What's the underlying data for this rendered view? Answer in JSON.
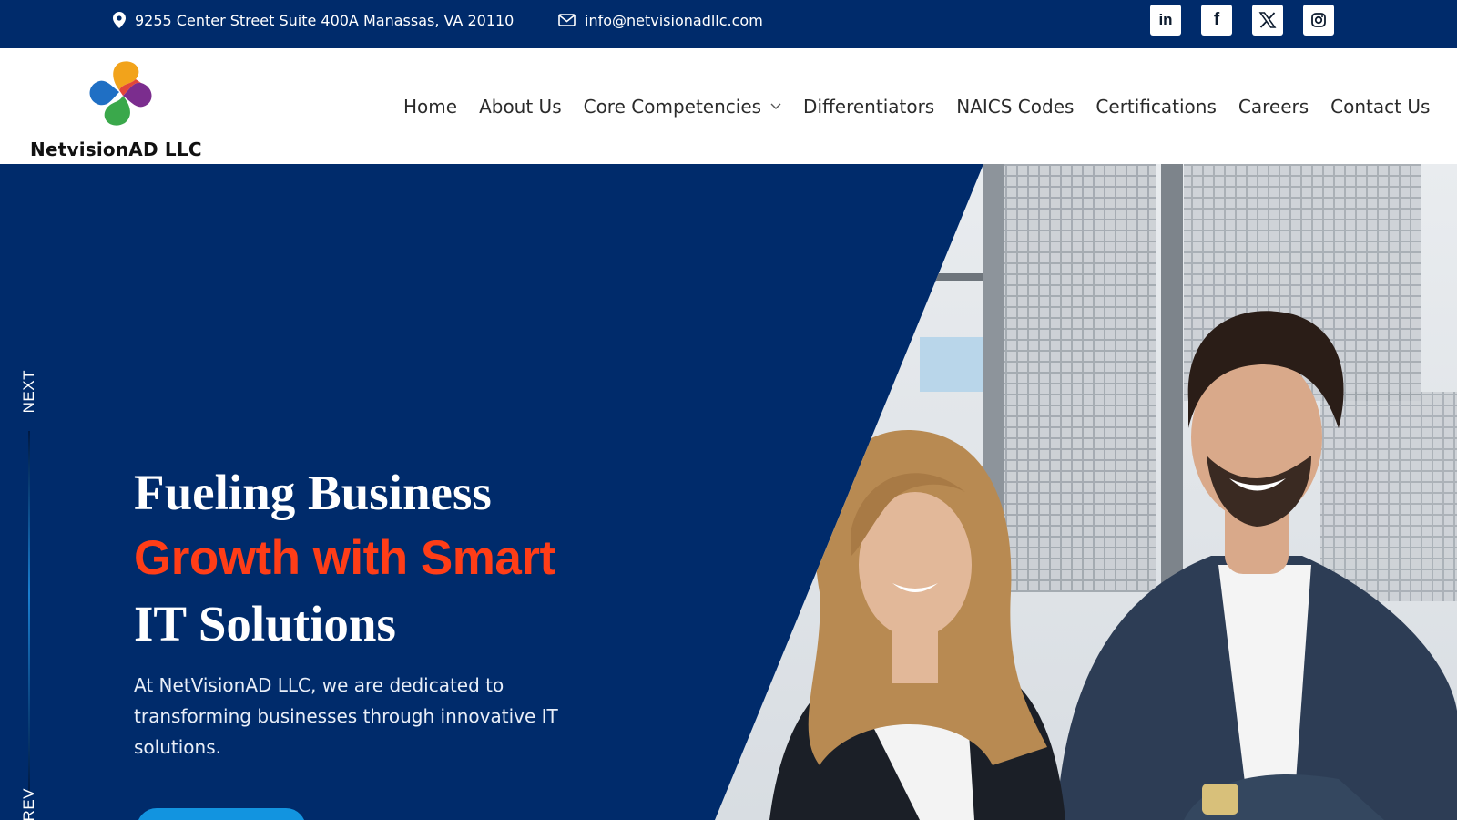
{
  "topbar": {
    "address": "9255 Center Street Suite 400A Manassas, VA 20110",
    "address_icon": "map-pin-icon",
    "email": "info@netvisionadllc.com",
    "email_icon": "envelope-icon",
    "socials": [
      {
        "name": "linkedin",
        "glyph": "in"
      },
      {
        "name": "facebook",
        "glyph": "f"
      },
      {
        "name": "x-twitter",
        "glyph": "X"
      },
      {
        "name": "instagram",
        "glyph": "instagram"
      }
    ],
    "colors": {
      "background": "#002b6b",
      "text": "#ffffff"
    }
  },
  "header": {
    "logo_text": "NetvisionAD LLC",
    "nav": [
      {
        "label": "Home"
      },
      {
        "label": "About Us"
      },
      {
        "label": "Core Competencies",
        "has_dropdown": true
      },
      {
        "label": "Differentiators"
      },
      {
        "label": "NAICS Codes"
      },
      {
        "label": "Certifications"
      },
      {
        "label": "Careers"
      },
      {
        "label": "Contact Us"
      }
    ]
  },
  "hero": {
    "slider": {
      "next_label": "NEXT",
      "prev_label": "PREV"
    },
    "headline": {
      "line1": "Fueling Business",
      "line2": "Growth with Smart",
      "line3": "IT Solutions"
    },
    "description": "At NetVisionAD LLC, we are dedicated to transforming businesses through innovative IT solutions.",
    "colors": {
      "background": "#002b6b",
      "accent": "#ff3d17",
      "button": "#1294e0"
    }
  }
}
